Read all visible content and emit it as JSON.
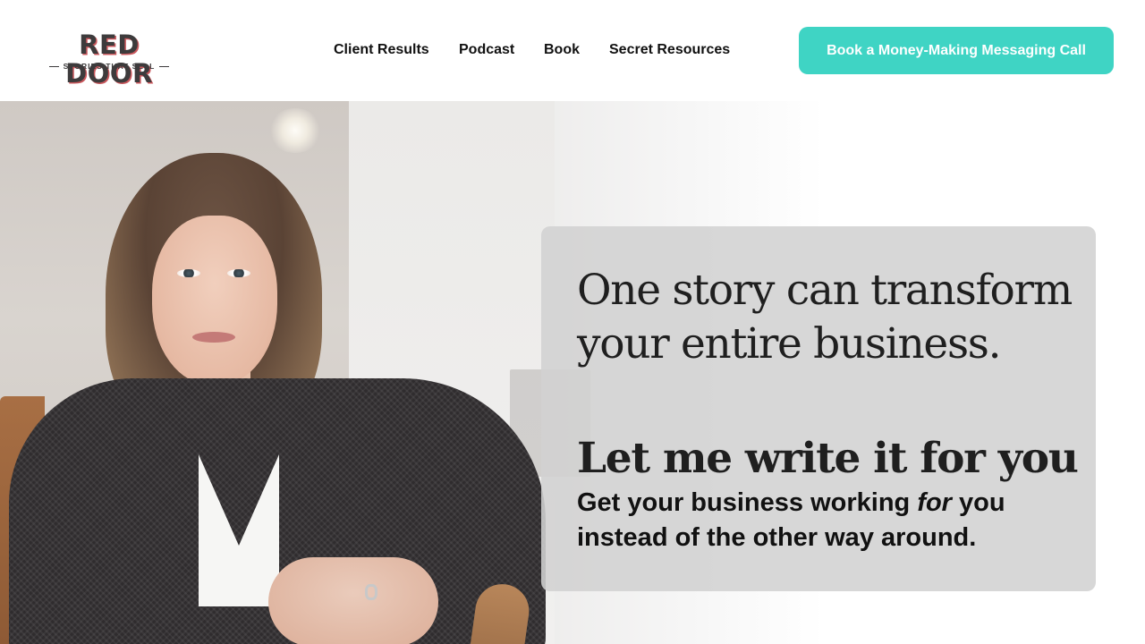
{
  "logo": {
    "name": "RED DOOR",
    "tagline": "STORIES THAT SELL"
  },
  "nav": {
    "items": [
      {
        "label": "Client Results"
      },
      {
        "label": "Podcast"
      },
      {
        "label": "Book"
      },
      {
        "label": "Secret Resources"
      }
    ],
    "cta_label": "Book a Money-Making Messaging Call"
  },
  "hero": {
    "headline": "One story can transform your entire business.",
    "headline2": "Let me write it for you",
    "subline_part1": "Get your business working ",
    "subline_emphasis": "for",
    "subline_part2": " you instead of the other way around."
  },
  "colors": {
    "accent": "#3fd4c4",
    "logo_text": "#3d3b3c",
    "logo_shadow": "#c9575c",
    "text_dark": "#111111"
  }
}
